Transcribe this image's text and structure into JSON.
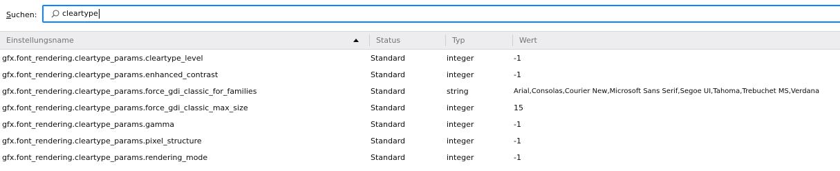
{
  "search": {
    "label_accel": "S",
    "label_rest": "uchen:",
    "value": "cleartype"
  },
  "table": {
    "columns": [
      {
        "label": "Einstellungsname"
      },
      {
        "label": "Status"
      },
      {
        "label": "Typ"
      },
      {
        "label": "Wert"
      }
    ],
    "sort_icon": "triangle-up-icon",
    "rows": [
      {
        "name": "gfx.font_rendering.cleartype_params.cleartype_level",
        "status": "Standard",
        "type": "integer",
        "value": "-1"
      },
      {
        "name": "gfx.font_rendering.cleartype_params.enhanced_contrast",
        "status": "Standard",
        "type": "integer",
        "value": "-1"
      },
      {
        "name": "gfx.font_rendering.cleartype_params.force_gdi_classic_for_families",
        "status": "Standard",
        "type": "string",
        "value": "Arial,Consolas,Courier New,Microsoft Sans Serif,Segoe UI,Tahoma,Trebuchet MS,Verdana"
      },
      {
        "name": "gfx.font_rendering.cleartype_params.force_gdi_classic_max_size",
        "status": "Standard",
        "type": "integer",
        "value": "15"
      },
      {
        "name": "gfx.font_rendering.cleartype_params.gamma",
        "status": "Standard",
        "type": "integer",
        "value": "-1"
      },
      {
        "name": "gfx.font_rendering.cleartype_params.pixel_structure",
        "status": "Standard",
        "type": "integer",
        "value": "-1"
      },
      {
        "name": "gfx.font_rendering.cleartype_params.rendering_mode",
        "status": "Standard",
        "type": "integer",
        "value": "-1"
      }
    ]
  },
  "colors": {
    "focus_border": "#0a84ff",
    "header_bg": "#ededf0",
    "header_text": "#737373"
  }
}
